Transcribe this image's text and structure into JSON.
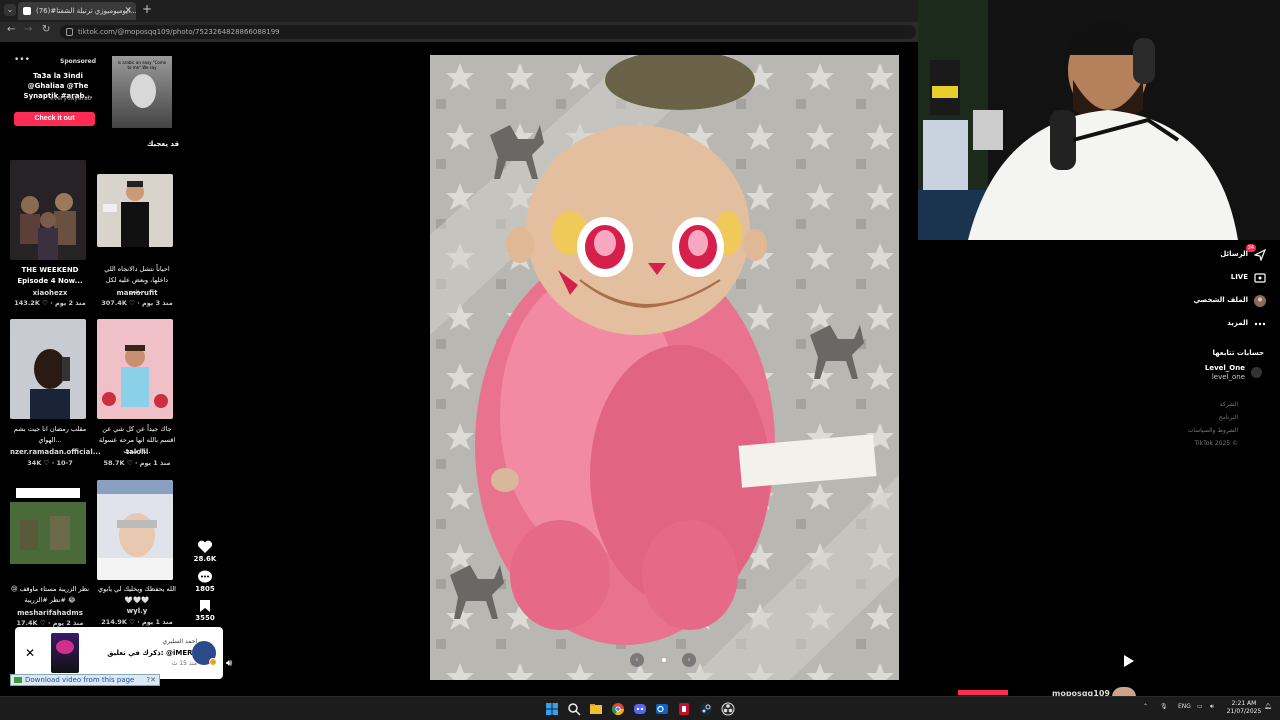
{
  "browser": {
    "tab_title": "(76)#ايوميوميوزي ترتيلة الشفتا...",
    "url": "tiktok.com/@moposqq109/photo/7523264828866088199"
  },
  "sponsored": {
    "label": "Sponsored",
    "text": "Ta3a la 3indi @Ghaliaa @The Synaptik #arab...",
    "user": "everydayarab",
    "cta": "Check it out",
    "thumb_caption": "is arabic an easy \"Come to me\" We say"
  },
  "you_may_like": "قد يعجبك",
  "cards": [
    {
      "caption": "THE WEEKEND Episode 4 Now...",
      "author": "xiaohezx",
      "meta": "143.2K ♡ · منذ 2 يوم"
    },
    {
      "caption": "احياناً نتشل دالانجاه اللي داخلها، وبعض عليه لكل شي...",
      "author": "mamorufit",
      "meta": "307.4K ♡ · منذ 3 يوم"
    },
    {
      "caption": "مقلب رمضان انا جيت بشم الهواي...",
      "author": "nzer.ramadan.official...",
      "meta": "34K ♡ · 10-7"
    },
    {
      "caption": "جاك جيداً عن كل شي عن اقسم بالله انها مرحه عسولة !! سنب...",
      "author": "talolil",
      "meta": "58.7K ♡ · منذ 1 يوم"
    },
    {
      "caption": "نظر الزريبة مستاء ماوقف 😢 #نظر #الزريبة 😂",
      "author": "meshari̇fahadms",
      "meta": "17.4K ♡ · منذ 2 يوم"
    },
    {
      "caption": "الله يحفظك ويخليك لي يابوي 🤍🤍🤍",
      "author": "wyl.y",
      "meta": "214.9K ♡ · منذ 1 يوم"
    }
  ],
  "engagement": {
    "likes": "28.6K",
    "comments": "1805",
    "saves": "3550"
  },
  "notification": {
    "title": "احمد السلبري",
    "text": "ذكرك في تعليق: @iMERT",
    "time": "منذ 15 ث"
  },
  "download_bar": "Download video from this page",
  "right_menu": [
    {
      "label": "الرسائل",
      "icon": "send-icon",
      "badge": "34"
    },
    {
      "label": "LIVE",
      "icon": "live-icon"
    },
    {
      "label": "الملف الشخصي",
      "icon": "profile-icon"
    },
    {
      "label": "المزيد",
      "icon": "more-icon"
    }
  ],
  "following_title": "حسابات تتابعها",
  "following": {
    "name": "Level_One",
    "handle": "level_one"
  },
  "footer": [
    "الشركة",
    "البرنامج",
    "الشروط والسياسات",
    "TikTok 2025 ©"
  ],
  "bottom_username": "moposqq109",
  "tray": {
    "lang": "ENG",
    "time": "2:21 AM",
    "date": "21/07/2025"
  }
}
